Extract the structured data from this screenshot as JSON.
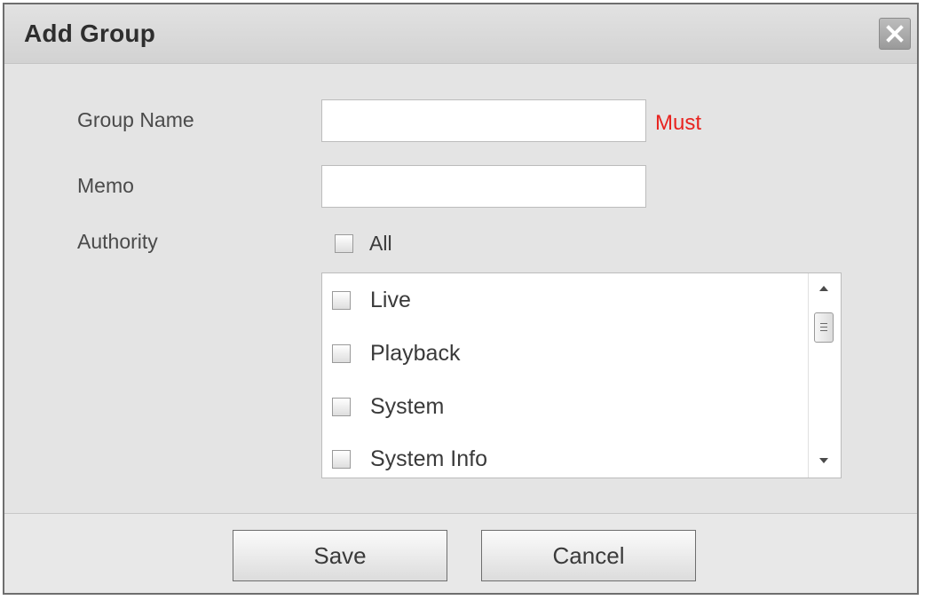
{
  "dialog": {
    "title": "Add Group",
    "close_icon": "close-x-icon"
  },
  "form": {
    "group_name": {
      "label": "Group Name",
      "value": "",
      "required_text": "Must"
    },
    "memo": {
      "label": "Memo",
      "value": ""
    },
    "authority": {
      "label": "Authority",
      "all_label": "All",
      "all_checked": false,
      "items": [
        {
          "label": "Live",
          "checked": false
        },
        {
          "label": "Playback",
          "checked": false
        },
        {
          "label": "System",
          "checked": false
        },
        {
          "label": "System Info",
          "checked": false
        }
      ]
    }
  },
  "footer": {
    "save_label": "Save",
    "cancel_label": "Cancel"
  },
  "colors": {
    "required": "#e8231f",
    "dialog_bg": "#e4e4e4"
  }
}
